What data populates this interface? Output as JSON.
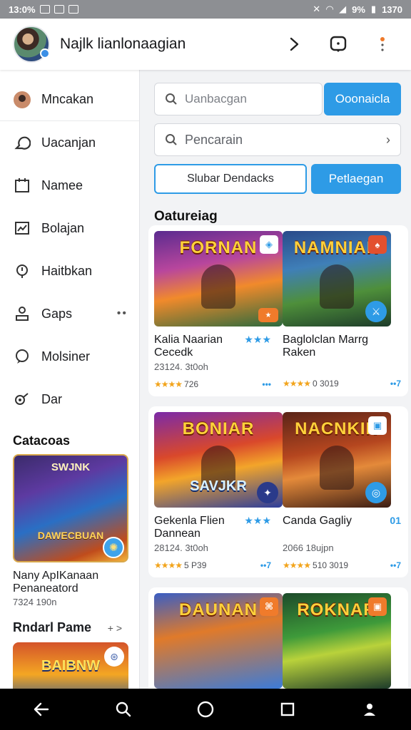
{
  "status_bar": {
    "time": "13:0%",
    "battery": "9%",
    "clock_right": "1370"
  },
  "header": {
    "title": "Najlk lianlonaagian"
  },
  "sidebar": {
    "items": [
      {
        "label": "Mncakan",
        "icon": "avatar-icon"
      },
      {
        "label": "Uacanjan",
        "icon": "chat-icon"
      },
      {
        "label": "Namee",
        "icon": "calendar-icon"
      },
      {
        "label": "Bolajan",
        "icon": "chart-icon"
      },
      {
        "label": "Haitbkan",
        "icon": "pin-icon"
      },
      {
        "label": "Gaps",
        "icon": "person-icon",
        "more": "••"
      },
      {
        "label": "Molsiner",
        "icon": "comment-icon"
      },
      {
        "label": "Dar",
        "icon": "tool-icon"
      }
    ],
    "section_title": "Catacoas",
    "featured": {
      "logo": "SWJNK",
      "banner": "DAWECBUAN",
      "title": "Nany ApIKanaan Penaneatord",
      "meta": "7324 190n"
    },
    "section2_title": "Rndarl Pame",
    "section2_arrow": "+ >",
    "featured2": {
      "logo": "BAIBNW"
    }
  },
  "main": {
    "search1": {
      "placeholder": "Uanbacgan"
    },
    "btn_primary": "Ooonaicla",
    "search2": {
      "value": "Pencarain"
    },
    "seg_outline": "Slubar  Dendacks",
    "btn_secondary": "Petlaegan",
    "section_title": "Oatureiag",
    "cards": [
      {
        "logo": "FORNAN",
        "title": "Kalia Naarian Cecedk",
        "meta": "23124. 3t0oh",
        "stars": "★★★★",
        "rating": "726",
        "mini": "★★★",
        "more": "•••",
        "tag": "◈"
      },
      {
        "logo": "NAMNIAN",
        "title": "Baglolclan Marrg Raken",
        "meta": "",
        "stars": "★★★★",
        "rating": "0 3019",
        "mini": "",
        "more": "••7",
        "tag": "♠"
      },
      {
        "logo": "BONIAR",
        "sub": "SAVJKR",
        "title": "Gekenla Flien Dannean",
        "meta": "28124. 3t0oh",
        "stars": "★★★★",
        "rating": "5 P39",
        "mini": "★★★",
        "more": "••7",
        "tag": ""
      },
      {
        "logo": "NACNKIN",
        "title": "Canda Gagliy",
        "meta": "2066 18ujpn",
        "stars": "★★★★",
        "rating": "510 3019",
        "mini": "01",
        "more": "••7",
        "tag": "▣"
      },
      {
        "logo": "DAUNAN",
        "title": "",
        "meta": "",
        "stars": "",
        "rating": "",
        "mini": "",
        "more": "",
        "tag": "⌘"
      },
      {
        "logo": "ROKNAR",
        "title": "",
        "meta": "",
        "stars": "",
        "rating": "",
        "mini": "",
        "more": "",
        "tag": "▣"
      }
    ]
  },
  "colors": {
    "accent": "#2e9be6",
    "star": "#f2a41c"
  }
}
